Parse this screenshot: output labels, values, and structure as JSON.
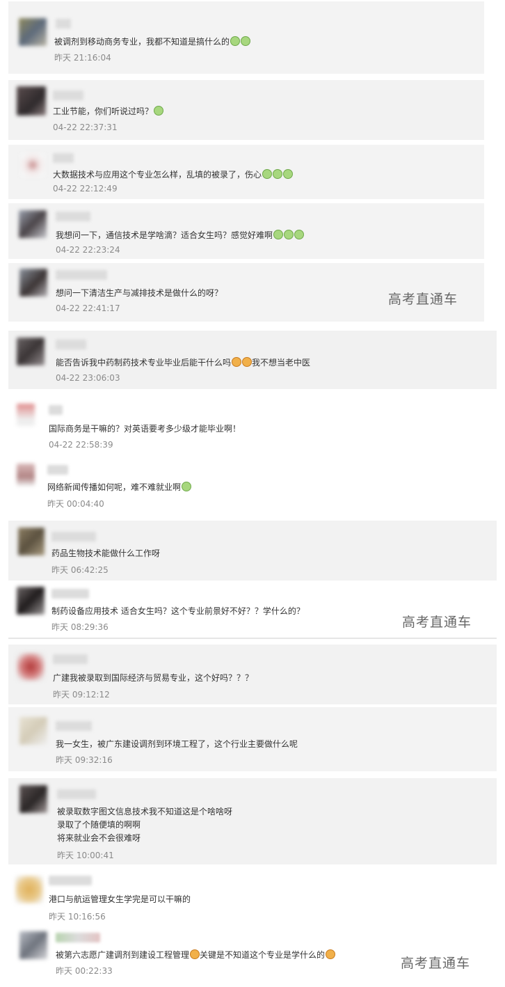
{
  "watermark": "高考直通车",
  "comments": [
    {
      "text_a": "被调剂到移动商务专业，我都不知道是搞什么的",
      "emojis_a": [
        "green",
        "green"
      ],
      "text_b": "",
      "emojis_b": [],
      "time": "昨天 21:16:04"
    },
    {
      "text_a": "工业节能，你们听说过吗？",
      "emojis_a": [
        "green"
      ],
      "text_b": "",
      "emojis_b": [],
      "time": "04-22 22:37:31"
    },
    {
      "text_a": "大数据技术与应用这个专业怎么样，乱填的被录了，伤心",
      "emojis_a": [
        "green",
        "green",
        "green"
      ],
      "text_b": "",
      "emojis_b": [],
      "time": "04-22 22:12:49"
    },
    {
      "text_a": "我想问一下，通信技术是学啥滴？适合女生吗？感觉好难啊",
      "emojis_a": [
        "green",
        "green",
        "green"
      ],
      "text_b": "",
      "emojis_b": [],
      "time": "04-22 22:23:24"
    },
    {
      "text_a": "想问一下清洁生产与减排技术是做什么的呀？",
      "emojis_a": [],
      "text_b": "",
      "emojis_b": [],
      "time": "04-22 22:41:17"
    },
    {
      "text_a": "能否告诉我中药制药技术专业毕业后能干什么吗",
      "emojis_a": [
        "orange",
        "orange"
      ],
      "text_b": "我不想当老中医",
      "emojis_b": [],
      "time": "04-22 23:06:03"
    },
    {
      "text_a": "国际商务是干嘛的？对英语要考多少级才能毕业啊！",
      "emojis_a": [],
      "text_b": "",
      "emojis_b": [],
      "time": "04-22 22:58:39"
    },
    {
      "text_a": "网络新闻传播如何呢，难不难就业啊",
      "emojis_a": [
        "green"
      ],
      "text_b": "",
      "emojis_b": [],
      "time": "昨天 00:04:40"
    },
    {
      "text_a": "药品生物技术能做什么工作呀",
      "emojis_a": [],
      "text_b": "",
      "emojis_b": [],
      "time": "昨天 06:42:25"
    },
    {
      "text_a": "制药设备应用技术   适合女生吗？这个专业前景好不好？？学什么的？",
      "emojis_a": [],
      "text_b": "",
      "emojis_b": [],
      "time": "昨天 08:29:36"
    },
    {
      "text_a": "广建我被录取到国际经济与贸易专业，这个好吗？？？",
      "emojis_a": [],
      "text_b": "",
      "emojis_b": [],
      "time": "昨天 09:12:12"
    },
    {
      "text_a": "我一女生，被广东建设调剂到环境工程了，这个行业主要做什么呢",
      "emojis_a": [],
      "text_b": "",
      "emojis_b": [],
      "time": "昨天 09:32:16"
    },
    {
      "text_a": "被录取数字图文信息技术我不知道这是个啥啥呀\n录取了个随便填的啊啊\n将来就业会不会很难呀",
      "emojis_a": [],
      "text_b": "",
      "emojis_b": [],
      "time": "昨天 10:00:41"
    },
    {
      "text_a": "港口与航运管理女生学完是可以干嘛的",
      "emojis_a": [],
      "text_b": "",
      "emojis_b": [],
      "time": "昨天 10:16:56"
    },
    {
      "text_a": "被第六志愿广建调剂到建设工程管理",
      "emojis_a": [
        "orange"
      ],
      "text_b": "关键是不知道这个专业是学什么的",
      "emojis_b": [
        "orange"
      ],
      "time": "昨天 00:22:33"
    }
  ]
}
